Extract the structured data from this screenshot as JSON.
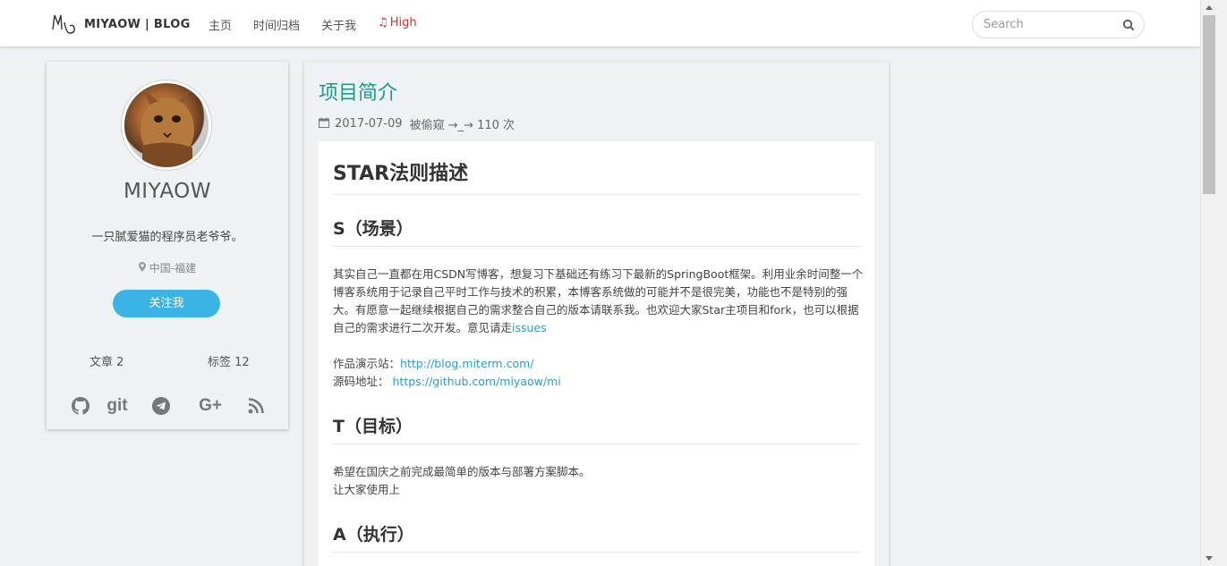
{
  "nav": {
    "brand": "MIYAOW | BLOG",
    "links": [
      "主页",
      "时间归档",
      "关于我"
    ],
    "high": "High"
  },
  "search": {
    "placeholder": "Search"
  },
  "profile": {
    "name": "MIYAOW",
    "bio": "一只腻爱猫的程序员老爷爷。",
    "location": "中国-福建",
    "follow_label": "关注我",
    "articles": "文章 2",
    "tags": "标签 12",
    "socials": [
      "github-icon",
      "git-icon",
      "telegram-icon",
      "google-plus-icon",
      "rss-icon"
    ],
    "git_text": "git",
    "gplus_text": "G+"
  },
  "article": {
    "title": "项目简介",
    "date": "2017-07-09",
    "views": "被偷窥 →_→ 110 次",
    "h1": "STAR法则描述",
    "s_heading": "S（场景）",
    "s_para": "其实自己一直都在用CSDN写博客，想复习下基础还有练习下最新的SpringBoot框架。利用业余时间整一个博客系统用于记录自己平时工作与技术的积累，本博客系统做的可能并不是很完美，功能也不是特别的强大。有愿意一起继续根据自己的需求整合自己的版本请联系我。也欢迎大家Star主项目和fork，也可以根据自己的需求进行二次开发。意见请走",
    "issues_link": "issues",
    "demo_label": "作品演示站：",
    "demo_url": "http://blog.miterm.com/",
    "source_label": "源码地址：",
    "source_url": "https://github.com/miyaow/mi",
    "t_heading": "T（目标）",
    "t_line1": "希望在国庆之前完成最简单的版本与部署方案脚本。",
    "t_line2": "让大家使用上",
    "a_heading": "A（执行）"
  },
  "colors": {
    "accent": "#1a9c8b",
    "button": "#3bb4e5",
    "link": "#2e9bd0",
    "high": "#e0282c"
  }
}
